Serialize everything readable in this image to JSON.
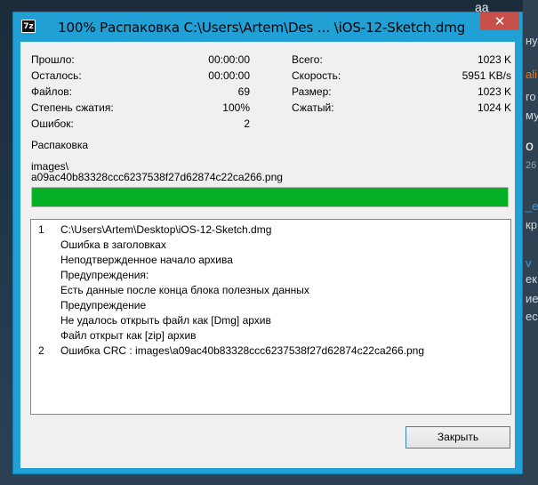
{
  "window": {
    "title": "100% Распаковка C:\\Users\\Artem\\Des ... \\iOS-12-Sketch.dmg",
    "app_icon": "7z",
    "close_glyph": "✕"
  },
  "stats_left": [
    {
      "label": "Прошло:",
      "value": "00:00:00"
    },
    {
      "label": "Осталось:",
      "value": "00:00:00"
    },
    {
      "label": "Файлов:",
      "value": "69"
    },
    {
      "label": "Степень сжатия:",
      "value": "100%"
    },
    {
      "label": "Ошибок:",
      "value": "2"
    }
  ],
  "stats_right": [
    {
      "label": "Всего:",
      "value": "1023 K"
    },
    {
      "label": "Скорость:",
      "value": "5951 KB/s"
    },
    {
      "label": "Размер:",
      "value": "1023 K"
    },
    {
      "label": "Сжатый:",
      "value": "1024 K"
    }
  ],
  "operation": "Распаковка",
  "current_file": {
    "line1": "images\\",
    "line2": "a09ac40b83328ccc6237538f27d62874c22ca266.png"
  },
  "progress": {
    "percent": 100,
    "color": "#06b025"
  },
  "log": [
    {
      "num": "1",
      "text": "C:\\Users\\Artem\\Desktop\\iOS-12-Sketch.dmg"
    },
    {
      "num": "",
      "text": "Ошибка в заголовках"
    },
    {
      "num": "",
      "text": "Неподтвержденное начало архива"
    },
    {
      "num": "",
      "text": "Предупреждения:"
    },
    {
      "num": "",
      "text": "Есть данные после конца блока полезных данных"
    },
    {
      "num": "",
      "text": "Предупреждение"
    },
    {
      "num": "",
      "text": "Не удалось открыть файл как [Dmg] архив"
    },
    {
      "num": "",
      "text": "Файл открыт как [zip] архив"
    },
    {
      "num": "2",
      "text": "Ошибка CRC : images\\a09ac40b83328ccc6237538f27d62874c22ca266.png"
    }
  ],
  "close_button": "Закрыть",
  "background": {
    "top_text": "aa",
    "right_fragments": [
      "ну",
      "ali",
      "ro",
      "му",
      "o",
      "26",
      "_e",
      "кр",
      "v",
      "ек",
      "ие",
      "ест"
    ]
  },
  "colors": {
    "titlebar": "#21a0d6",
    "close_red": "#c7504a",
    "button_border": "#3c7fb1"
  }
}
